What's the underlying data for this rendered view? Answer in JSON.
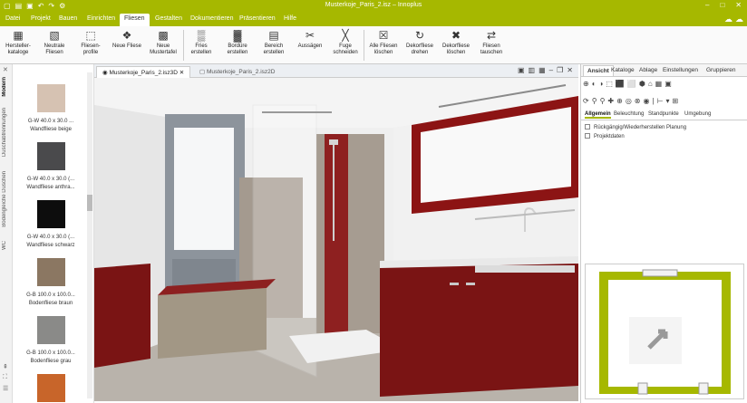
{
  "window": {
    "title": "Musterkoje_Paris_2.isz – Innoplus",
    "minimize": "–",
    "maximize": "□",
    "close": "✕"
  },
  "menu": [
    "Datei",
    "Projekt",
    "Bauen",
    "Einrichten",
    "Fliesen",
    "Gestalten",
    "Dokumentieren",
    "Präsentieren",
    "Hilfe"
  ],
  "active_menu": "Fliesen",
  "ribbon": [
    {
      "l1": "Hersteller-",
      "l2": "kataloge",
      "icon": "▦"
    },
    {
      "l1": "Neutrale",
      "l2": "Fliesen",
      "icon": "▧"
    },
    {
      "l1": "Fliesen-",
      "l2": "profile",
      "icon": "⬚"
    },
    {
      "l1": "Neue Fliese",
      "l2": "",
      "icon": "❖"
    },
    {
      "l1": "Neue",
      "l2": "Mustertafel",
      "icon": "▩"
    },
    {
      "l1": "Fries",
      "l2": "erstellen",
      "icon": "▒"
    },
    {
      "l1": "Bordüre",
      "l2": "erstellen",
      "icon": "▓"
    },
    {
      "l1": "Bereich",
      "l2": "erstellen",
      "icon": "▤"
    },
    {
      "l1": "Aussägen",
      "l2": "",
      "icon": "✂"
    },
    {
      "l1": "Fuge",
      "l2": "schneiden",
      "icon": "╳"
    },
    {
      "l1": "Alle Fliesen",
      "l2": "löschen",
      "icon": "☒"
    },
    {
      "l1": "Dekorfliese",
      "l2": "drehen",
      "icon": "↻"
    },
    {
      "l1": "Dekorfliese",
      "l2": "löschen",
      "icon": "✖"
    },
    {
      "l1": "Fliesen",
      "l2": "tauschen",
      "icon": "⇄"
    }
  ],
  "left_tabs": [
    "Modern",
    "Duschabtrennungen",
    "Bodengleiche Duschen",
    "WC"
  ],
  "left_active": "Modern",
  "catalog": [
    {
      "size": "G-W 40.0 x 30.0 ...",
      "name": "Wandfliese beige",
      "color": "#d6c2b2"
    },
    {
      "size": "G-W 40.0 x 30.0 (...",
      "name": "Wandfliese anthra...",
      "color": "#4a4a4c"
    },
    {
      "size": "G-W 40.0 x 30.0 (...",
      "name": "Wandfliese schwarz",
      "color": "#0d0d0d"
    },
    {
      "size": "G-B 100.0 x 100.0...",
      "name": "Bodenfliese braun",
      "color": "#8b7762"
    },
    {
      "size": "G-B 100.0 x 100.0...",
      "name": "Bodenfliese grau",
      "color": "#8a8a88"
    },
    {
      "size": "",
      "name": "",
      "color": "#c8652a"
    }
  ],
  "doc_tabs": [
    "Musterkoje_Paris_2.isz3D",
    "Musterkoje_Paris_2.isz2D"
  ],
  "right_tabs": [
    "Ansicht",
    "Kataloge",
    "Ablage",
    "Einstellungen",
    "Gruppieren"
  ],
  "right_active": "Ansicht",
  "sub_tabs": [
    "Allgemein",
    "Beleuchtung",
    "Standpunkte",
    "Umgebung"
  ],
  "sub_active": "Allgemein",
  "tree": [
    "Rückgängig/Wiederherstellen Planung",
    "Projektdaten"
  ],
  "colors": {
    "accent": "#a6b800",
    "cabinet": "#7a1414",
    "mirror": "#8c1414"
  }
}
